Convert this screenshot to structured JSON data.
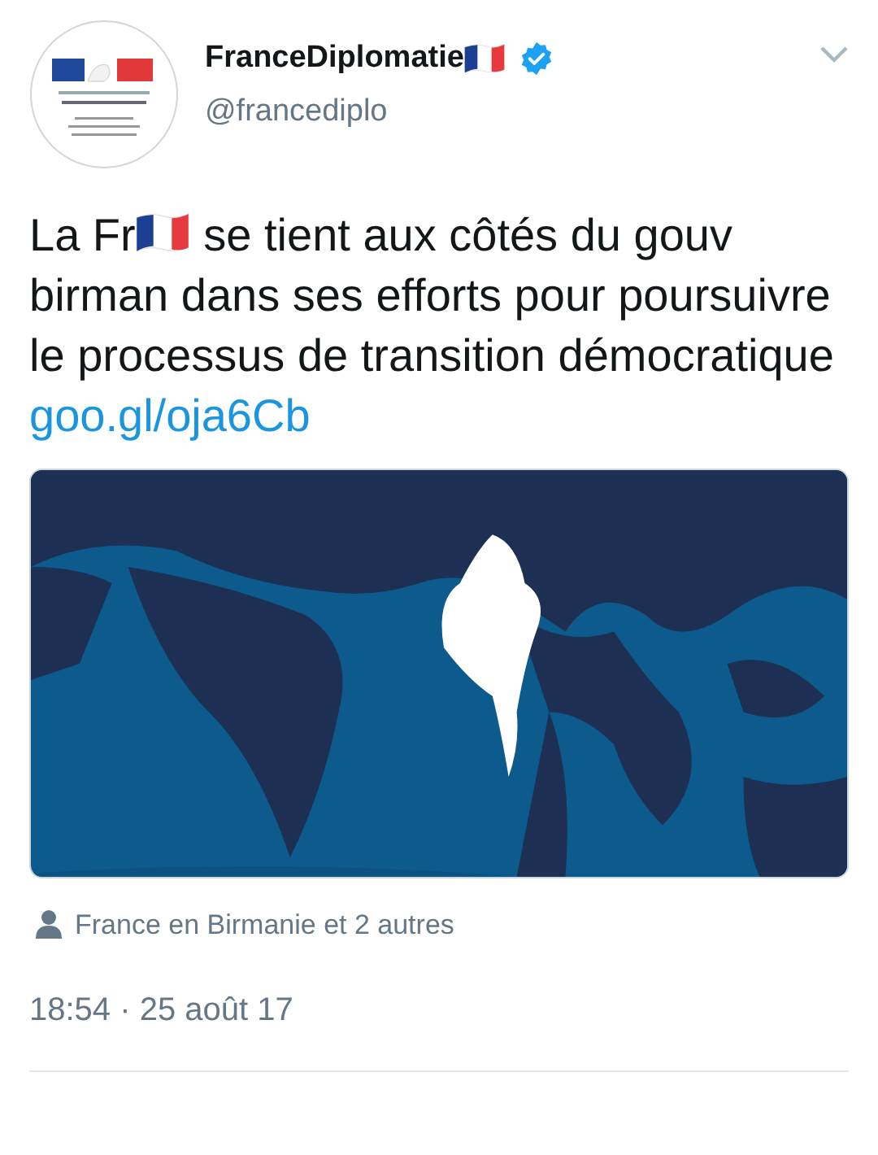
{
  "author": {
    "name": "FranceDiplomatie",
    "verified": true,
    "handle": "@francediplo"
  },
  "tweet": {
    "text_before_flag": "La Fr",
    "text_after_flag": "se tient aux côtés du gouv birman dans ses efforts pour poursuivre le processus de transition démocratique",
    "link": "goo.gl/oja6Cb"
  },
  "tagged": "France en Birmanie et 2 autres",
  "timestamp": "18:54 · 25 août 17"
}
